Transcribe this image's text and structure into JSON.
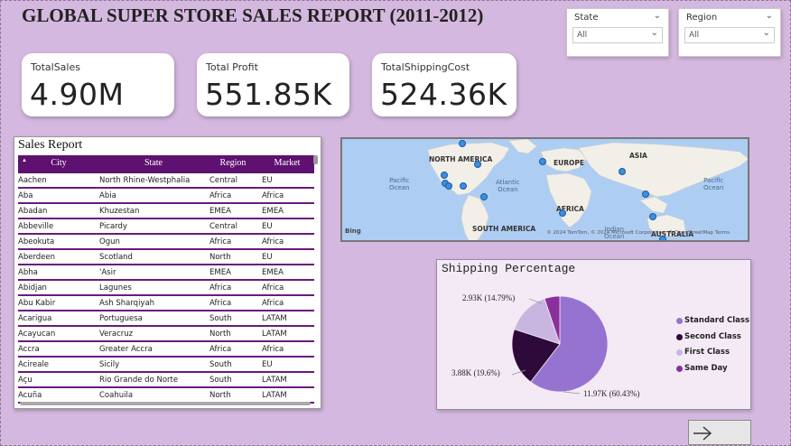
{
  "report": {
    "title": "GLOBAL SUPER STORE SALES REPORT (2011-2012)"
  },
  "filters": {
    "state": {
      "label": "State",
      "value": "All"
    },
    "region": {
      "label": "Region",
      "value": "All"
    }
  },
  "kpis": {
    "total_sales": {
      "label": "TotalSales",
      "value": "4.90M"
    },
    "total_profit": {
      "label": "Total Profit",
      "value": "551.85K"
    },
    "total_shipping": {
      "label": "TotalShippingCost",
      "value": "524.36K"
    }
  },
  "sales_table": {
    "title": "Sales Report",
    "columns": [
      "City",
      "State",
      "Region",
      "Market"
    ],
    "rows": [
      [
        "Aachen",
        "North Rhine-Westphalia",
        "Central",
        "EU"
      ],
      [
        "Aba",
        "Abia",
        "Africa",
        "Africa"
      ],
      [
        "Abadan",
        "Khuzestan",
        "EMEA",
        "EMEA"
      ],
      [
        "Abbeville",
        "Picardy",
        "Central",
        "EU"
      ],
      [
        "Abeokuta",
        "Ogun",
        "Africa",
        "Africa"
      ],
      [
        "Aberdeen",
        "Scotland",
        "North",
        "EU"
      ],
      [
        "Abha",
        "'Asir",
        "EMEA",
        "EMEA"
      ],
      [
        "Abidjan",
        "Lagunes",
        "Africa",
        "Africa"
      ],
      [
        "Abu Kabir",
        "Ash Sharqiyah",
        "Africa",
        "Africa"
      ],
      [
        "Acarigua",
        "Portuguesa",
        "South",
        "LATAM"
      ],
      [
        "Acayucan",
        "Veracruz",
        "North",
        "LATAM"
      ],
      [
        "Accra",
        "Greater Accra",
        "Africa",
        "Africa"
      ],
      [
        "Acireale",
        "Sicily",
        "South",
        "EU"
      ],
      [
        "Açu",
        "Rio Grande do Norte",
        "South",
        "LATAM"
      ],
      [
        "Acuña",
        "Coahuila",
        "North",
        "LATAM"
      ]
    ]
  },
  "map": {
    "labels": {
      "north_america": "NORTH AMERICA",
      "europe": "EUROPE",
      "asia": "ASIA",
      "africa": "AFRICA",
      "south_america": "SOUTH AMERICA",
      "australia": "AUSTRALIA"
    },
    "oceans": {
      "pacific_left": "Pacific\nOcean",
      "atlantic": "Atlantic\nOcean",
      "pacific_right": "Pacific\nOcean",
      "indian": "Indian\nOcean"
    },
    "attribution": "© 2024 TomTom, © 2024 Microsoft Corporation, © OpenStreetMap Terms",
    "logo": "Bing",
    "water_color": "#aecdf2",
    "land_color": "#f2efe9",
    "point_color": "#3b8ee0"
  },
  "chart_data": {
    "type": "pie",
    "title": "Shipping Percentage",
    "categories": [
      "Standard Class",
      "Second Class",
      "First Class",
      "Same Day"
    ],
    "values": [
      11970,
      3880,
      2930,
      1030
    ],
    "percentages": [
      60.43,
      19.6,
      14.79,
      5.2
    ],
    "colors": [
      "#9673d0",
      "#2e0a3a",
      "#c8b6e0",
      "#8b2f9c"
    ],
    "data_labels": [
      "11.97K (60.43%)",
      "3.88K (19.6%)",
      "2.93K (14.79%)"
    ],
    "legend_position": "right"
  },
  "nav": {
    "next_icon": "arrow-right-icon"
  }
}
